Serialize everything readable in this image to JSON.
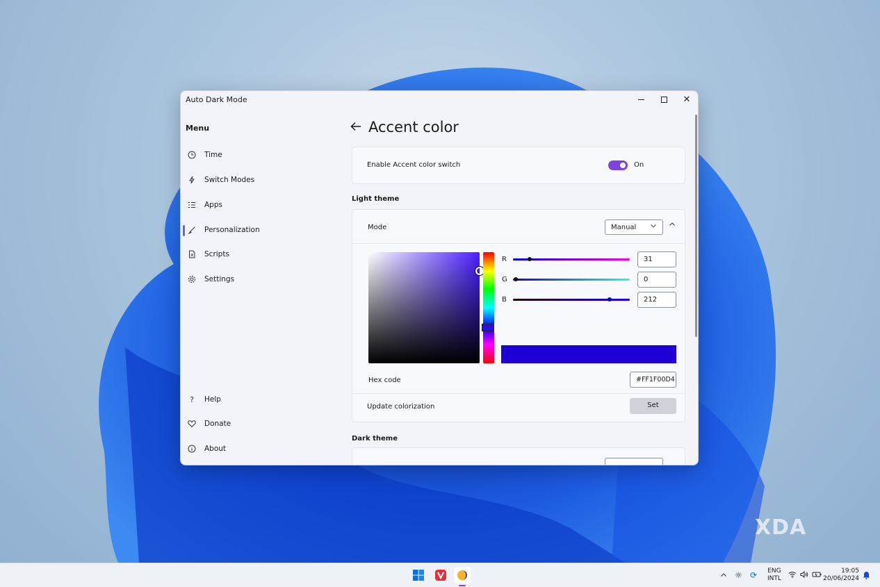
{
  "window": {
    "title": "Auto Dark Mode",
    "controls": {
      "minimize": "minimize-icon",
      "maximize": "maximize-icon",
      "close": "✕"
    }
  },
  "sidebar": {
    "menu_title": "Menu",
    "items": [
      {
        "label": "Time",
        "icon": "clock-icon"
      },
      {
        "label": "Switch Modes",
        "icon": "bolt-icon"
      },
      {
        "label": "Apps",
        "icon": "list-icon"
      },
      {
        "label": "Personalization",
        "icon": "brush-icon",
        "active": true
      },
      {
        "label": "Scripts",
        "icon": "document-icon"
      },
      {
        "label": "Settings",
        "icon": "gear-icon"
      }
    ],
    "footer_items": [
      {
        "label": "Help",
        "icon": "question-icon"
      },
      {
        "label": "Donate",
        "icon": "heart-icon"
      },
      {
        "label": "About",
        "icon": "info-icon"
      }
    ]
  },
  "page": {
    "title": "Accent color",
    "back_icon": "arrow-left-icon"
  },
  "accent_switch": {
    "label": "Enable Accent color switch",
    "state": "On",
    "enabled": true,
    "color": "#7b44e0"
  },
  "light_theme": {
    "heading": "Light theme",
    "mode_label": "Mode",
    "mode_value": "Manual",
    "channels": [
      {
        "name": "R",
        "value": "31"
      },
      {
        "name": "G",
        "value": "0"
      },
      {
        "name": "B",
        "value": "212"
      }
    ],
    "hex_label": "Hex code",
    "hex_value": "#FF1F00D4",
    "preview_color": "#1f00d4",
    "update_label": "Update colorization",
    "set_button": "Set"
  },
  "dark_theme": {
    "heading": "Dark theme"
  },
  "taskbar": {
    "language": "ENG",
    "layout": "INTL",
    "time": "19:05",
    "date": "20/06/2024"
  },
  "watermark": "XDA"
}
